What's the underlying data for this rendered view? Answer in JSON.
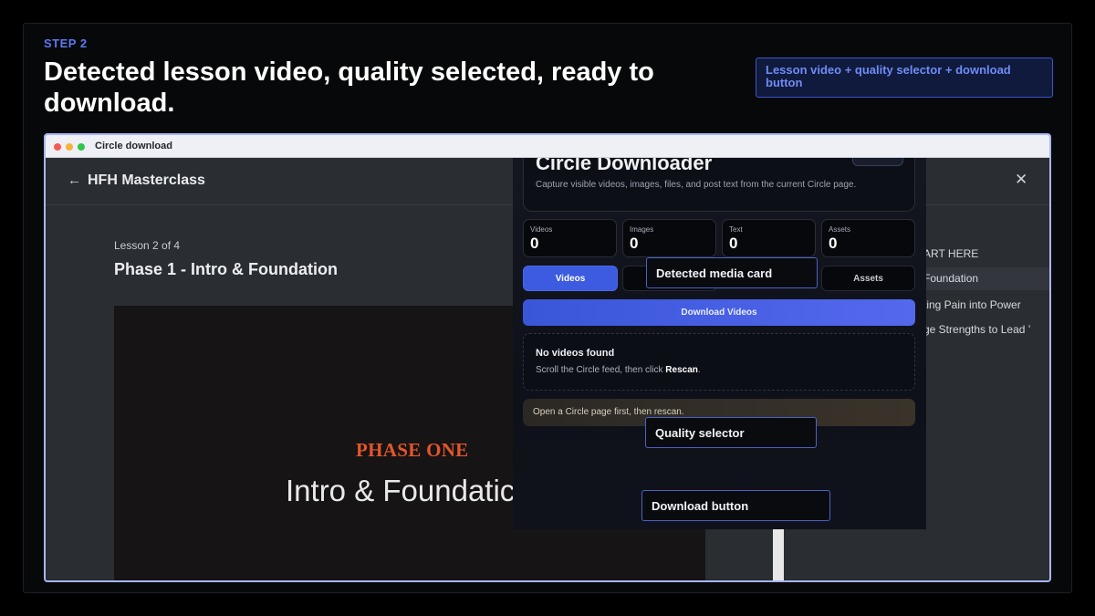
{
  "step_label": "STEP 2",
  "headline": "Detected lesson video, quality selected, ready to download.",
  "tag": "Lesson video + quality selector + download button",
  "window": {
    "title": "Circle download"
  },
  "app": {
    "course_title": "HFH Masterclass",
    "lesson_count": "Lesson 2 of 4",
    "lesson_title": "Phase 1 - Intro & Foundation",
    "video": {
      "kicker": "PHASE ONE",
      "subtitle": "Intro & Foundatic"
    },
    "sidebar": [
      "ART HERE",
      "Foundation",
      "ting Pain into Power",
      "ge Strengths to Lead ʼ"
    ]
  },
  "panel": {
    "title": "Circle Downloader",
    "description": "Capture visible videos, images, files, and post text from the current Circle page.",
    "stats": [
      {
        "label": "Videos",
        "value": "0"
      },
      {
        "label": "Images",
        "value": "0"
      },
      {
        "label": "Text",
        "value": "0"
      },
      {
        "label": "Assets",
        "value": "0"
      }
    ],
    "tabs": [
      "Videos",
      "Assets"
    ],
    "download_label": "Download Videos",
    "empty_title": "No videos found",
    "empty_desc_before": "Scroll the Circle feed, then click ",
    "empty_desc_bold": "Rescan",
    "empty_desc_after": ".",
    "notice": "Open a Circle page first, then rescan."
  },
  "callouts": {
    "media_card": "Detected media card",
    "quality": "Quality selector",
    "download": "Download button"
  },
  "colors": {
    "accent": "#5b78f0",
    "button": "#3c5be0",
    "phase": "#e4562a"
  }
}
